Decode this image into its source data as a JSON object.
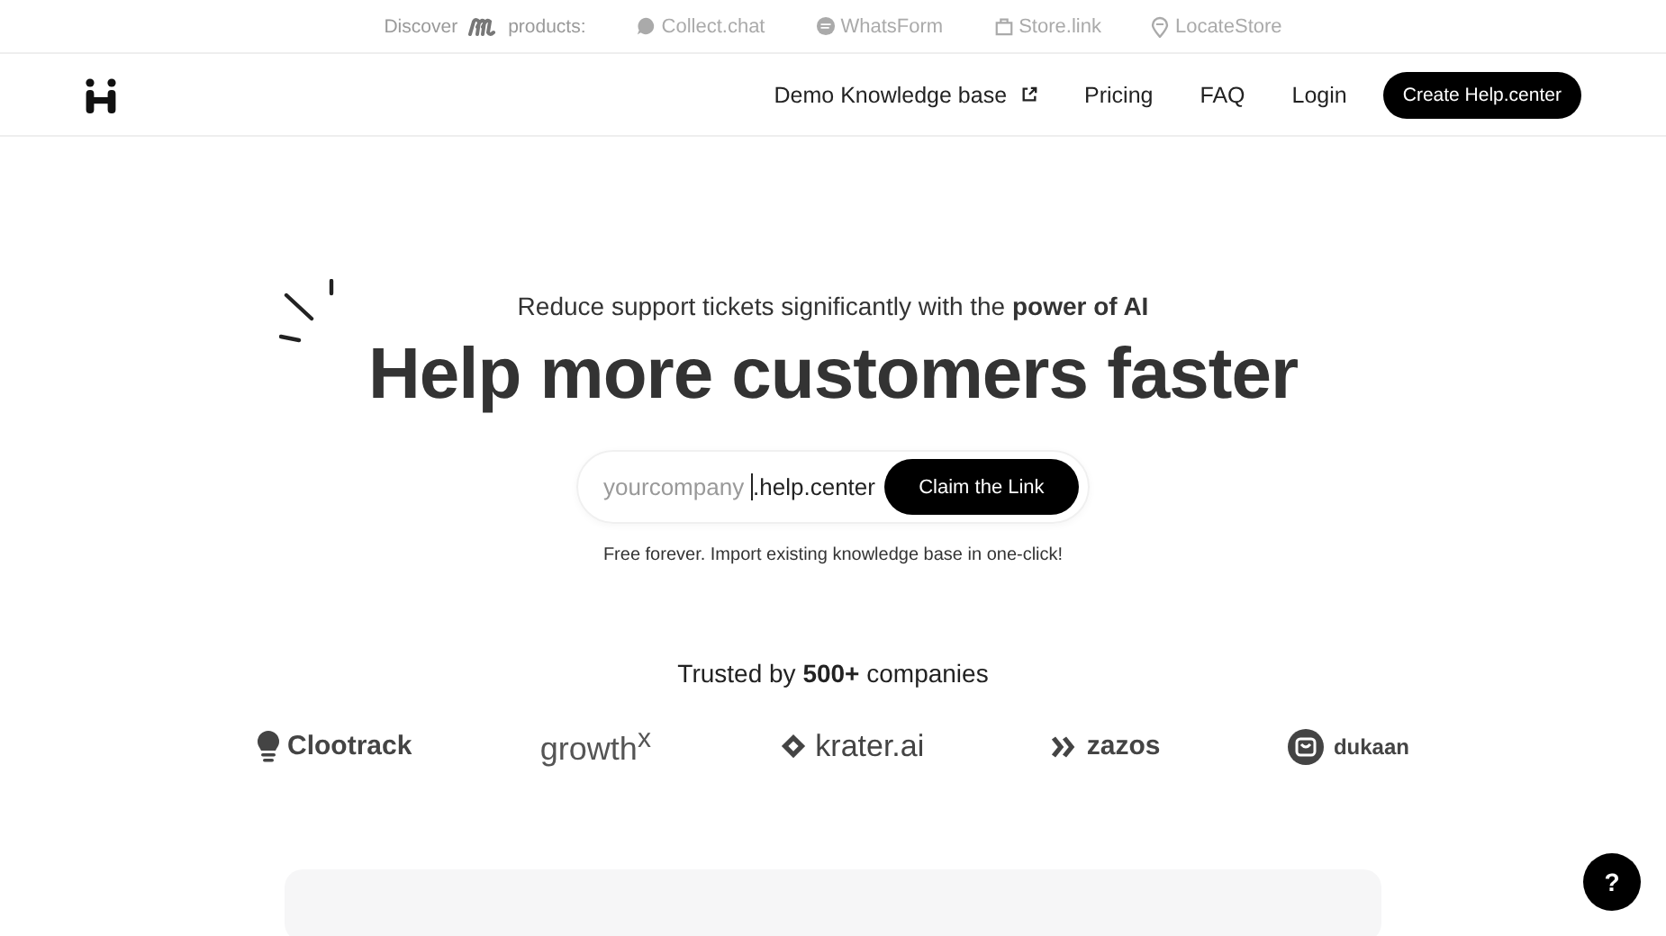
{
  "promo_bar": {
    "prefix": "Discover",
    "suffix": "products:",
    "products": [
      {
        "name": "Collect.chat",
        "kind": "chat"
      },
      {
        "name": "WhatsForm",
        "kind": "form"
      },
      {
        "name": "Store.link",
        "kind": "bag"
      },
      {
        "name": "LocateStore",
        "kind": "pin"
      }
    ]
  },
  "nav": {
    "links": [
      {
        "label": "Demo Knowledge base",
        "external": true
      },
      {
        "label": "Pricing",
        "external": false
      },
      {
        "label": "FAQ",
        "external": false
      },
      {
        "label": "Login",
        "external": false
      }
    ],
    "cta": "Create Help.center"
  },
  "hero": {
    "tagline": "Reduce support tickets significantly with the **power of AI**",
    "title": "Help more customers faster",
    "field": {
      "placeholder": "yourcompany",
      "suffix": ".help.center"
    },
    "button": "Claim the Link",
    "note": "Free forever. Import existing knowledge base in one-click!"
  },
  "trusted": {
    "heading": "Trusted by **500+** companies",
    "logos": [
      {
        "name": "Clootrack",
        "kind": "bulb"
      },
      {
        "name": "growth$^{x}$",
        "kind": "none"
      },
      {
        "name": "krater.ai",
        "kind": "diamond"
      },
      {
        "name": "zazos",
        "kind": "chevrons"
      },
      {
        "name": "dukaan",
        "kind": "bag-circle"
      }
    ]
  },
  "help_button": "?"
}
